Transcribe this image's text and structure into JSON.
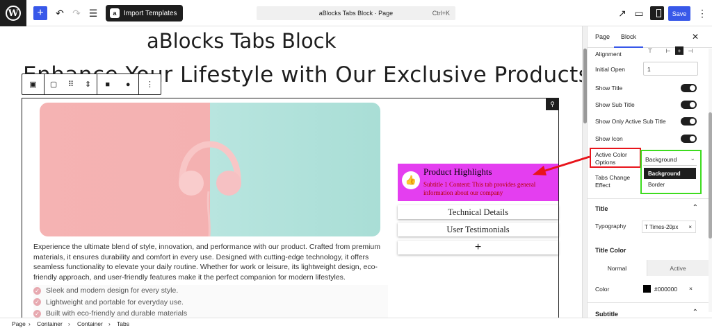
{
  "topbar": {
    "import_label": "Import Templates",
    "command_title": "aBlocks Tabs Block · Page",
    "shortcut": "Ctrl+K",
    "save_label": "Save"
  },
  "editor": {
    "page_title": "aBlocks Tabs Block",
    "heading_visible": "Enhance Your Lifestyle with Our Exclusive Products",
    "description": "Experience the ultimate blend of style, innovation, and performance with our product. Crafted from premium materials, it ensures durability and comfort in every use. Designed with cutting-edge technology, it offers seamless functionality to elevate your daily routine. Whether for work or leisure, its lightweight design, eco-friendly approach, and user-friendly features make it the perfect companion for modern lifestyles.",
    "features": [
      "Sleek and modern design for every style.",
      "Lightweight and portable for everyday use.",
      "Built with eco-friendly and durable materials"
    ]
  },
  "tabs": {
    "active_title": "Product Highlights",
    "active_subtitle": "Subtitle 1 Content: This tab provides general information about our company",
    "items": [
      "Technical Details",
      "User Testimonials"
    ],
    "add_label": "+"
  },
  "sidebar": {
    "tab_page": "Page",
    "tab_block": "Block",
    "alignment_label": "Alignment",
    "initial_open_label": "Initial Open",
    "initial_open_value": "1",
    "toggles": [
      "Show Title",
      "Show Sub Title",
      "Show Only Active Sub Title",
      "Show Icon"
    ],
    "active_color_label": "Active Color Options",
    "active_color_value": "Background",
    "dropdown_options": [
      "Background",
      "Border"
    ],
    "tabs_change_effect_label": "Tabs Change Effect",
    "section_title": "Title",
    "typography_label": "Typography",
    "typography_value": "Times-20px",
    "title_color_label": "Title Color",
    "segment_normal": "Normal",
    "segment_active": "Active",
    "color_label": "Color",
    "color_value": "#000000",
    "section_subtitle": "Subtitle"
  },
  "footer": {
    "breadcrumbs": [
      "Page",
      "Container",
      "Container",
      "Tabs"
    ]
  },
  "colors": {
    "accent": "#3858e9",
    "active_tab_bg": "#e43ef0",
    "highlight_red": "#e8141b",
    "highlight_green": "#3ddc1e"
  }
}
